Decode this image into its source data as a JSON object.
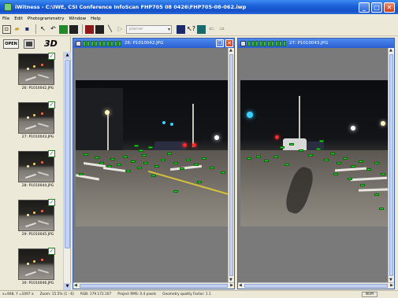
{
  "window": {
    "title": "iWitness - C:\\IWE, CSI Conference InfoScan FHP705 08 0426\\FHP705-08-062.iwp",
    "minimize": "_",
    "maximize": "□",
    "close": "✕"
  },
  "menu": [
    "File",
    "Edit",
    "Photogrammetry",
    "Window",
    "Help"
  ],
  "toolbar": {
    "combo_value": "planar"
  },
  "left_panel": {
    "open_label": "OPEN",
    "mode_3d_label": "3D",
    "thumbnails": [
      {
        "label": "26: P1010042.JPG",
        "checked": true
      },
      {
        "label": "27: P1010043.JPG",
        "checked": true
      },
      {
        "label": "28: P1010044.JPG",
        "checked": true
      },
      {
        "label": "29: P1010045.JPG",
        "checked": true
      },
      {
        "label": "30: P1010046.JPG",
        "checked": true
      }
    ]
  },
  "image_windows": [
    {
      "title": "26: P1010042.JPG"
    },
    {
      "title": "27: P1010043.JPG"
    }
  ],
  "status_bar": {
    "coords": "x=948, Y =1097 a",
    "zoom": "Zoom: 15.5% (1 : 6)",
    "rgb": "RGB: 179.172.167",
    "rmse": "Project RMS: 0.4 pixels",
    "geometry": "Geometry quality Factor: 1.1",
    "num": "NUM"
  },
  "colors": {
    "title_bar": "#1a5fd6",
    "feature_point": "#22e022",
    "panel_bg": "#ece9d8",
    "image_bg": "#7a7a7a"
  }
}
